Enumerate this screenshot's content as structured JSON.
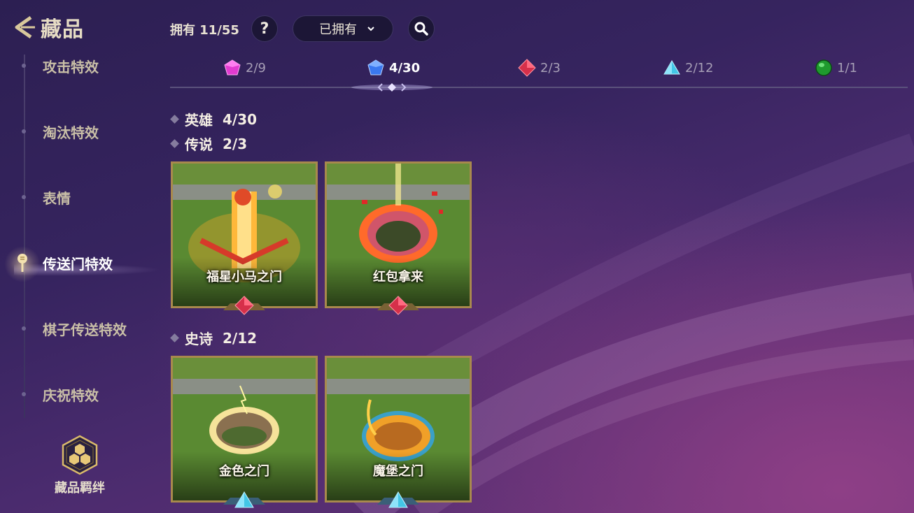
{
  "header": {
    "title": "藏品",
    "owned_label": "拥有 11/55",
    "help_label": "?",
    "filter": {
      "selected": "已拥有"
    }
  },
  "sidebar": {
    "items": [
      {
        "label": "攻击特效",
        "active": false
      },
      {
        "label": "淘汰特效",
        "active": false
      },
      {
        "label": "表情",
        "active": false
      },
      {
        "label": "传送门特效",
        "active": true
      },
      {
        "label": "棋子传送特效",
        "active": false
      },
      {
        "label": "庆祝特效",
        "active": false
      }
    ],
    "bond_label": "藏品羁绊"
  },
  "rarity_tabs": [
    {
      "count": "2/9",
      "gem": "pink-gem-icon",
      "color": "#e23bd0"
    },
    {
      "count": "4/30",
      "gem": "blue-gem-icon",
      "color": "#3a78f0",
      "active": true
    },
    {
      "count": "2/3",
      "gem": "red-gem-icon",
      "color": "#d6304a"
    },
    {
      "count": "2/12",
      "gem": "cyan-triangle-icon",
      "color": "#43c6e6"
    },
    {
      "count": "1/1",
      "gem": "green-orb-icon",
      "color": "#1f9a2e"
    }
  ],
  "sections": {
    "hero": {
      "title": "英雄",
      "count": "4/30"
    },
    "legend": {
      "title": "传说",
      "count": "2/3"
    },
    "epic": {
      "title": "史诗",
      "count": "2/12"
    }
  },
  "cards": {
    "legend": [
      {
        "name": "福星小马之门",
        "rarity_icon": "red-gem-icon"
      },
      {
        "name": "红包拿来",
        "rarity_icon": "red-gem-icon"
      }
    ],
    "epic": [
      {
        "name": "金色之门",
        "rarity_icon": "cyan-triangle-icon"
      },
      {
        "name": "魔堡之门",
        "rarity_icon": "cyan-triangle-icon"
      }
    ]
  }
}
